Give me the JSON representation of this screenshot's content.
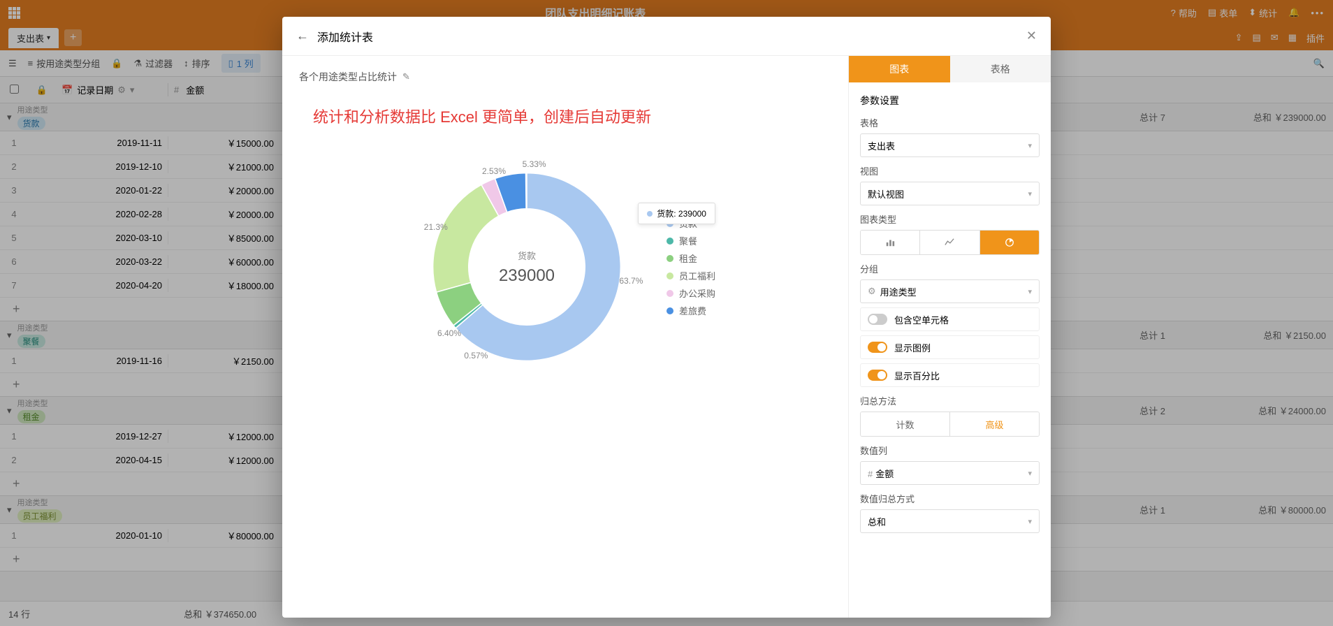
{
  "header": {
    "title": "团队支出明细记账表",
    "help": "帮助",
    "tables": "表单",
    "stats": "统计",
    "plugin": "插件"
  },
  "tab": {
    "active": "支出表"
  },
  "toolbar": {
    "group_by": "按用途类型分组",
    "filter": "过滤器",
    "sort": "排序",
    "columns": "1 列"
  },
  "columns": {
    "date": "记录日期",
    "amount": "金额"
  },
  "groups": [
    {
      "label": "用途类型",
      "tag": "货款",
      "tag_class": "tag-blue",
      "count": "总计 7",
      "sum": "总和 ￥239000.00",
      "rows": [
        {
          "n": 1,
          "date": "2019-11-11",
          "amt": "￥15000.00"
        },
        {
          "n": 2,
          "date": "2019-12-10",
          "amt": "￥21000.00"
        },
        {
          "n": 3,
          "date": "2020-01-22",
          "amt": "￥20000.00"
        },
        {
          "n": 4,
          "date": "2020-02-28",
          "amt": "￥20000.00"
        },
        {
          "n": 5,
          "date": "2020-03-10",
          "amt": "￥85000.00"
        },
        {
          "n": 6,
          "date": "2020-03-22",
          "amt": "￥60000.00"
        },
        {
          "n": 7,
          "date": "2020-04-20",
          "amt": "￥18000.00"
        }
      ]
    },
    {
      "label": "用途类型",
      "tag": "聚餐",
      "tag_class": "tag-teal",
      "count": "总计 1",
      "sum": "总和 ￥2150.00",
      "rows": [
        {
          "n": 1,
          "date": "2019-11-16",
          "amt": "￥2150.00"
        }
      ]
    },
    {
      "label": "用途类型",
      "tag": "租金",
      "tag_class": "tag-green",
      "count": "总计 2",
      "sum": "总和 ￥24000.00",
      "rows": [
        {
          "n": 1,
          "date": "2019-12-27",
          "amt": "￥12000.00"
        },
        {
          "n": 2,
          "date": "2020-04-15",
          "amt": "￥12000.00"
        }
      ]
    },
    {
      "label": "用途类型",
      "tag": "员工福利",
      "tag_class": "tag-lime",
      "count": "总计 1",
      "sum": "总和 ￥80000.00",
      "rows": [
        {
          "n": 1,
          "date": "2020-01-10",
          "amt": "￥80000.00"
        }
      ]
    }
  ],
  "footer": {
    "rows": "14 行",
    "total": "总和 ￥374650.00"
  },
  "modal": {
    "title": "添加统计表",
    "chart_title": "各个用途类型占比统计",
    "promo": "统计和分析数据比 Excel 更简单，创建后自动更新",
    "center_label": "货款",
    "center_value": "239000",
    "tooltip": "货款: 239000",
    "tabs": {
      "chart": "图表",
      "table": "表格"
    },
    "settings_title": "参数设置",
    "labels": {
      "table": "表格",
      "view": "视图",
      "chart_type": "图表类型",
      "group": "分组",
      "empty_cells": "包含空单元格",
      "show_legend": "显示图例",
      "show_percent": "显示百分比",
      "agg_method": "归总方法",
      "count": "计数",
      "advanced": "高级",
      "value_col": "数值列",
      "value_agg": "数值归总方式"
    },
    "values": {
      "table_select": "支出表",
      "view_select": "默认视图",
      "group_select": "用途类型",
      "value_col_select": "金额",
      "value_agg_select": "总和"
    }
  },
  "chart_data": {
    "type": "pie",
    "title": "各个用途类型占比统计",
    "series": [
      {
        "name": "货款",
        "value": 239000,
        "pct": 63.7,
        "color": "#a8c8f0"
      },
      {
        "name": "聚餐",
        "value": 2150,
        "pct": 0.57,
        "color": "#4db8a8"
      },
      {
        "name": "租金",
        "value": 24000,
        "pct": 6.4,
        "color": "#8cd080"
      },
      {
        "name": "员工福利",
        "value": 80000,
        "pct": 21.3,
        "color": "#c8e8a0"
      },
      {
        "name": "办公采购",
        "value": 9500,
        "pct": 2.53,
        "color": "#f0c8e8"
      },
      {
        "name": "差旅费",
        "value": 20000,
        "pct": 5.33,
        "color": "#4a90e2"
      }
    ],
    "center": {
      "label": "货款",
      "value": 239000
    }
  }
}
